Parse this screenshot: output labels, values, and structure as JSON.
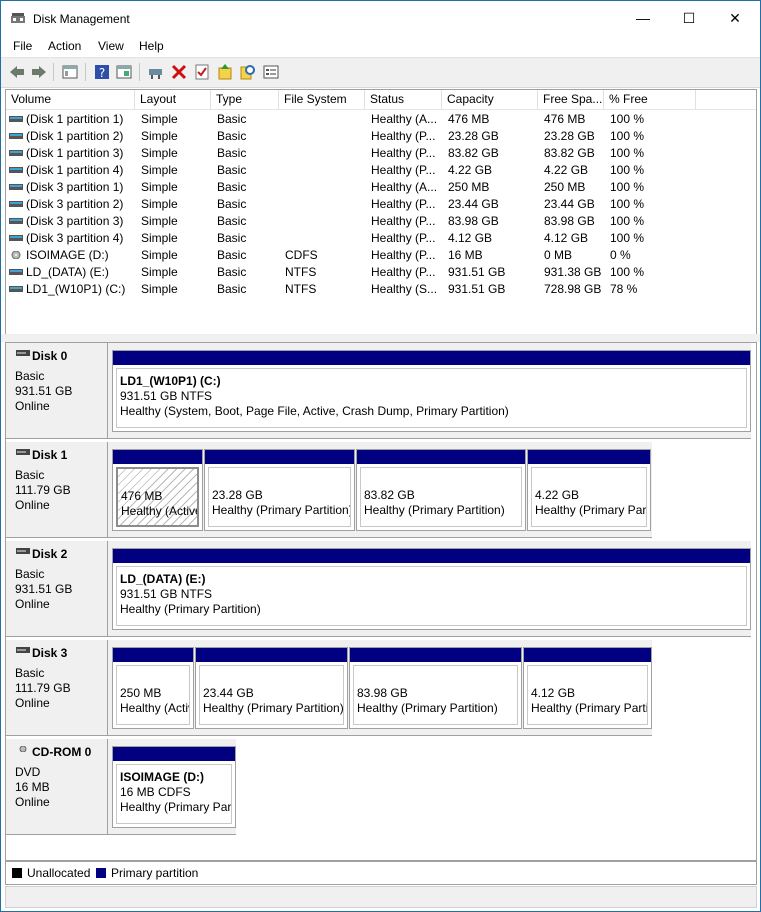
{
  "window": {
    "title": "Disk Management",
    "controls": {
      "minimize": "—",
      "maximize": "☐",
      "close": "✕"
    }
  },
  "menu": [
    {
      "label": "File"
    },
    {
      "label": "Action"
    },
    {
      "label": "View"
    },
    {
      "label": "Help"
    }
  ],
  "toolbar": [
    "back-arrow-icon",
    "forward-arrow-icon",
    "console-tree-icon",
    "help-icon",
    "properties-icon",
    "connect-icon",
    "delete-icon",
    "check-icon",
    "refresh-icon",
    "search-icon",
    "settings-icon"
  ],
  "columns": [
    {
      "label": "Volume"
    },
    {
      "label": "Layout"
    },
    {
      "label": "Type"
    },
    {
      "label": "File System"
    },
    {
      "label": "Status"
    },
    {
      "label": "Capacity"
    },
    {
      "label": "Free Spa..."
    },
    {
      "label": "% Free"
    }
  ],
  "volumes": [
    {
      "volume": "(Disk 1 partition 1)",
      "layout": "Simple",
      "type": "Basic",
      "fs": "",
      "status": "Healthy (A...",
      "capacity": "476 MB",
      "free": "476 MB",
      "pct": "100 %",
      "icon": "partition-icon"
    },
    {
      "volume": "(Disk 1 partition 2)",
      "layout": "Simple",
      "type": "Basic",
      "fs": "",
      "status": "Healthy (P...",
      "capacity": "23.28 GB",
      "free": "23.28 GB",
      "pct": "100 %",
      "icon": "partition-icon"
    },
    {
      "volume": "(Disk 1 partition 3)",
      "layout": "Simple",
      "type": "Basic",
      "fs": "",
      "status": "Healthy (P...",
      "capacity": "83.82 GB",
      "free": "83.82 GB",
      "pct": "100 %",
      "icon": "partition-icon"
    },
    {
      "volume": "(Disk 1 partition 4)",
      "layout": "Simple",
      "type": "Basic",
      "fs": "",
      "status": "Healthy (P...",
      "capacity": "4.22 GB",
      "free": "4.22 GB",
      "pct": "100 %",
      "icon": "partition-icon"
    },
    {
      "volume": "(Disk 3 partition 1)",
      "layout": "Simple",
      "type": "Basic",
      "fs": "",
      "status": "Healthy (A...",
      "capacity": "250 MB",
      "free": "250 MB",
      "pct": "100 %",
      "icon": "partition-icon"
    },
    {
      "volume": "(Disk 3 partition 2)",
      "layout": "Simple",
      "type": "Basic",
      "fs": "",
      "status": "Healthy (P...",
      "capacity": "23.44 GB",
      "free": "23.44 GB",
      "pct": "100 %",
      "icon": "partition-icon"
    },
    {
      "volume": "(Disk 3 partition 3)",
      "layout": "Simple",
      "type": "Basic",
      "fs": "",
      "status": "Healthy (P...",
      "capacity": "83.98 GB",
      "free": "83.98 GB",
      "pct": "100 %",
      "icon": "partition-icon"
    },
    {
      "volume": "(Disk 3 partition 4)",
      "layout": "Simple",
      "type": "Basic",
      "fs": "",
      "status": "Healthy (P...",
      "capacity": "4.12 GB",
      "free": "4.12 GB",
      "pct": "100 %",
      "icon": "partition-icon"
    },
    {
      "volume": "ISOIMAGE (D:)",
      "layout": "Simple",
      "type": "Basic",
      "fs": "CDFS",
      "status": "Healthy (P...",
      "capacity": "16 MB",
      "free": "0 MB",
      "pct": "0 %",
      "icon": "cd-icon"
    },
    {
      "volume": "LD_(DATA) (E:)",
      "layout": "Simple",
      "type": "Basic",
      "fs": "NTFS",
      "status": "Healthy (P...",
      "capacity": "931.51 GB",
      "free": "931.38 GB",
      "pct": "100 %",
      "icon": "partition-icon"
    },
    {
      "volume": "LD1_(W10P1) (C:)",
      "layout": "Simple",
      "type": "Basic",
      "fs": "NTFS",
      "status": "Healthy (S...",
      "capacity": "931.51 GB",
      "free": "728.98 GB",
      "pct": "78 %",
      "icon": "partition-icon"
    }
  ],
  "disks": [
    {
      "name": "Disk 0",
      "type": "Basic",
      "size": "931.51 GB",
      "state": "Online",
      "partitions": [
        {
          "name": "LD1_(W10P1)  (C:)",
          "size": "931.51 GB NTFS",
          "status": "Healthy (System, Boot, Page File, Active, Crash Dump, Primary Partition)"
        }
      ]
    },
    {
      "name": "Disk 1",
      "type": "Basic",
      "size": "111.79 GB",
      "state": "Online",
      "partitions": [
        {
          "name": "",
          "size": "476 MB",
          "status": "Healthy (Active, Primary Partition)",
          "selected": true
        },
        {
          "name": "",
          "size": "23.28 GB",
          "status": "Healthy (Primary Partition)"
        },
        {
          "name": "",
          "size": "83.82 GB",
          "status": "Healthy (Primary Partition)"
        },
        {
          "name": "",
          "size": "4.22 GB",
          "status": "Healthy (Primary Partition)"
        }
      ]
    },
    {
      "name": "Disk 2",
      "type": "Basic",
      "size": "931.51 GB",
      "state": "Online",
      "partitions": [
        {
          "name": "LD_(DATA)  (E:)",
          "size": "931.51 GB NTFS",
          "status": "Healthy (Primary Partition)"
        }
      ]
    },
    {
      "name": "Disk 3",
      "type": "Basic",
      "size": "111.79 GB",
      "state": "Online",
      "partitions": [
        {
          "name": "",
          "size": "250 MB",
          "status": "Healthy (Active, Primary Partition)"
        },
        {
          "name": "",
          "size": "23.44 GB",
          "status": "Healthy (Primary Partition)"
        },
        {
          "name": "",
          "size": "83.98 GB",
          "status": "Healthy (Primary Partition)"
        },
        {
          "name": "",
          "size": "4.12 GB",
          "status": "Healthy (Primary Partition)"
        }
      ]
    },
    {
      "name": "CD-ROM 0",
      "type": "DVD",
      "size": "16 MB",
      "state": "Online",
      "partitions": [
        {
          "name": "ISOIMAGE  (D:)",
          "size": "16 MB CDFS",
          "status": "Healthy (Primary Partition)"
        }
      ]
    }
  ],
  "legend": [
    {
      "label": "Unallocated",
      "color": "#000000"
    },
    {
      "label": "Primary partition",
      "color": "#000080"
    }
  ]
}
